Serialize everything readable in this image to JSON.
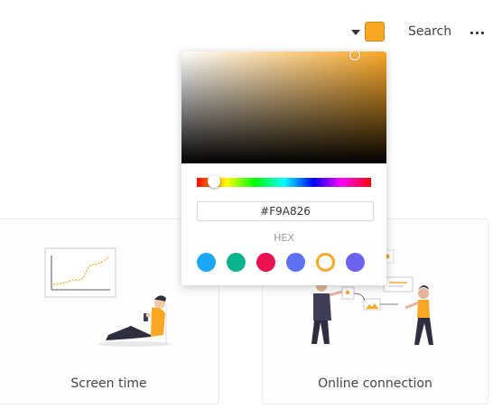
{
  "topbar": {
    "swatch_color": "#F9A826",
    "search_label": "Search"
  },
  "picker": {
    "hex_value": "#F9A826",
    "hex_label": "HEX",
    "hue_color": "#F9A826",
    "presets": [
      {
        "color": "#1AA7F5"
      },
      {
        "color": "#0DB38F"
      },
      {
        "color": "#E9114F"
      },
      {
        "color": "#5C72F0"
      },
      {
        "color": "#F9A826",
        "selected": true
      },
      {
        "color": "#6B63EE"
      }
    ]
  },
  "cards": [
    {
      "title": "Screen time"
    },
    {
      "title": "Online connection"
    }
  ],
  "accent_color": "#F9A826"
}
